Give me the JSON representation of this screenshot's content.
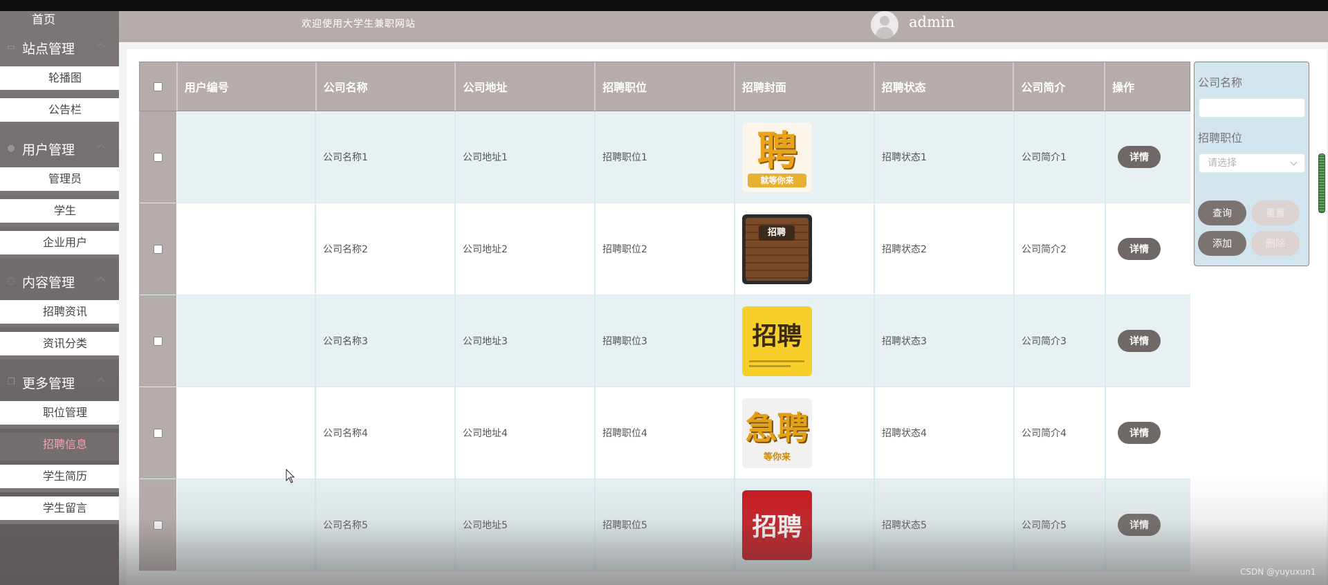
{
  "header": {
    "welcome": "欢迎使用大学生兼职网站",
    "username": "admin"
  },
  "sidebar": {
    "home": "首页",
    "groups": [
      {
        "label": "站点管理",
        "icon": "monitor-icon",
        "items": [
          "轮播图",
          "公告栏"
        ]
      },
      {
        "label": "用户管理",
        "icon": "user-icon",
        "items": [
          "管理员",
          "学生",
          "企业用户"
        ]
      },
      {
        "label": "内容管理",
        "icon": "chat-icon",
        "items": [
          "招聘资讯",
          "资讯分类"
        ]
      },
      {
        "label": "更多管理",
        "icon": "copy-icon",
        "items": [
          "职位管理",
          "招聘信息",
          "学生简历",
          "学生留言"
        ]
      }
    ],
    "active_item": "招聘信息"
  },
  "table": {
    "columns": [
      "用户编号",
      "公司名称",
      "公司地址",
      "招聘职位",
      "招聘封面",
      "招聘状态",
      "公司简介",
      "操作"
    ],
    "rows": [
      {
        "uid": "",
        "name": "公司名称1",
        "addr": "公司地址1",
        "pos": "招聘职位1",
        "cover_text": "聘",
        "cover_sub": "就等你来",
        "status": "招聘状态1",
        "intro": "公司简介1",
        "action": "详情"
      },
      {
        "uid": "",
        "name": "公司名称2",
        "addr": "公司地址2",
        "pos": "招聘职位2",
        "cover_text": "招聘",
        "cover_sub": "",
        "status": "招聘状态2",
        "intro": "公司简介2",
        "action": "详情"
      },
      {
        "uid": "",
        "name": "公司名称3",
        "addr": "公司地址3",
        "pos": "招聘职位3",
        "cover_text": "招聘",
        "cover_sub": "",
        "status": "招聘状态3",
        "intro": "公司简介3",
        "action": "详情"
      },
      {
        "uid": "",
        "name": "公司名称4",
        "addr": "公司地址4",
        "pos": "招聘职位4",
        "cover_text": "急聘",
        "cover_sub": "等你来",
        "status": "招聘状态4",
        "intro": "公司简介4",
        "action": "详情"
      },
      {
        "uid": "",
        "name": "公司名称5",
        "addr": "公司地址5",
        "pos": "招聘职位5",
        "cover_text": "招聘",
        "cover_sub": "",
        "status": "招聘状态5",
        "intro": "公司简介5",
        "action": "详情"
      }
    ]
  },
  "search": {
    "company_label": "公司名称",
    "position_label": "招聘职位",
    "position_placeholder": "请选择",
    "query": "查询",
    "reset": "重置",
    "add": "添加",
    "delete": "删除"
  },
  "watermark": "CSDN @yuyuxun1"
}
